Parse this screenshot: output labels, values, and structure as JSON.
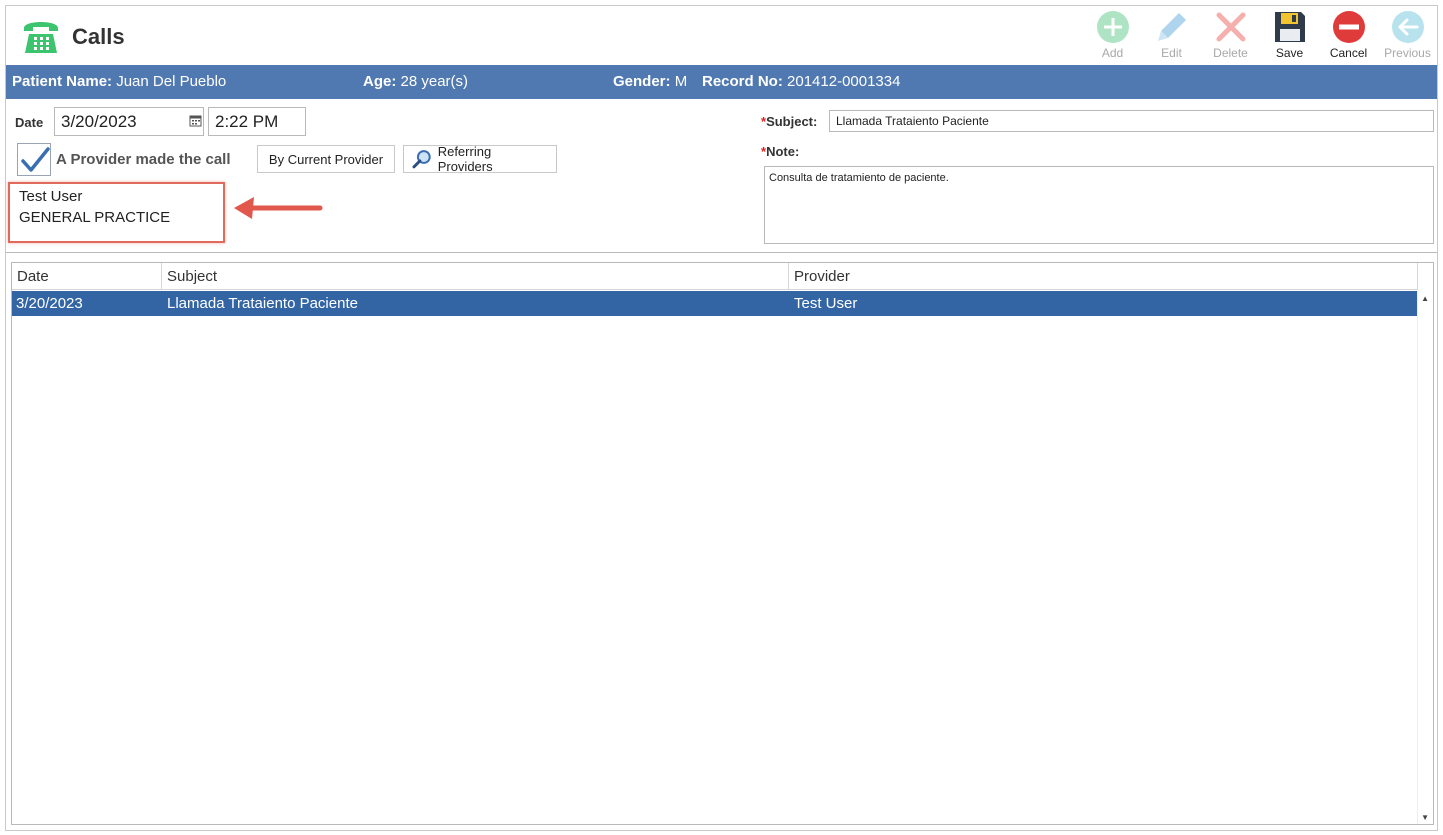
{
  "app": {
    "title": "Calls",
    "icon": "phone-icon"
  },
  "toolbar": {
    "add": {
      "label": "Add",
      "icon": "add-icon",
      "enabled": false
    },
    "edit": {
      "label": "Edit",
      "icon": "pencil-icon",
      "enabled": false
    },
    "delete": {
      "label": "Delete",
      "icon": "delete-icon",
      "enabled": false
    },
    "save": {
      "label": "Save",
      "icon": "save-icon",
      "enabled": true
    },
    "cancel": {
      "label": "Cancel",
      "icon": "cancel-icon",
      "enabled": true
    },
    "previous": {
      "label": "Previous",
      "icon": "back-arrow-icon",
      "enabled": false
    }
  },
  "patient": {
    "name_label": "Patient Name:",
    "name": "Juan Del Pueblo",
    "age_label": "Age:",
    "age": "28 year(s)",
    "gender_label": "Gender:",
    "gender": "M",
    "record_label": "Record No:",
    "record": "201412-0001334"
  },
  "form": {
    "date_label": "Date",
    "date": "3/20/2023",
    "time": "2:22 PM",
    "provider_call_label": "A Provider made the call",
    "provider_call_checked": true,
    "by_current_provider": "By Current Provider",
    "referring_providers": "Referring Providers",
    "provider_name": "Test User",
    "provider_specialty": "GENERAL PRACTICE",
    "required_mark": "*",
    "subject_label": "Subject:",
    "subject": "Llamada Trataiento Paciente",
    "note_label": "Note:",
    "note": "Consulta de tratamiento de paciente."
  },
  "grid": {
    "columns": [
      "Date",
      "Subject",
      "Provider"
    ],
    "rows": [
      {
        "date": "3/20/2023",
        "subject": "Llamada Trataiento Paciente",
        "provider": "Test User",
        "selected": true
      }
    ],
    "scroll_up": "▲",
    "scroll_down": "▼"
  },
  "colors": {
    "patient_bar": "#5079b1",
    "selected_row": "#3365a4",
    "highlight": "#e06a5c",
    "app_icon": "#3cc46f"
  }
}
